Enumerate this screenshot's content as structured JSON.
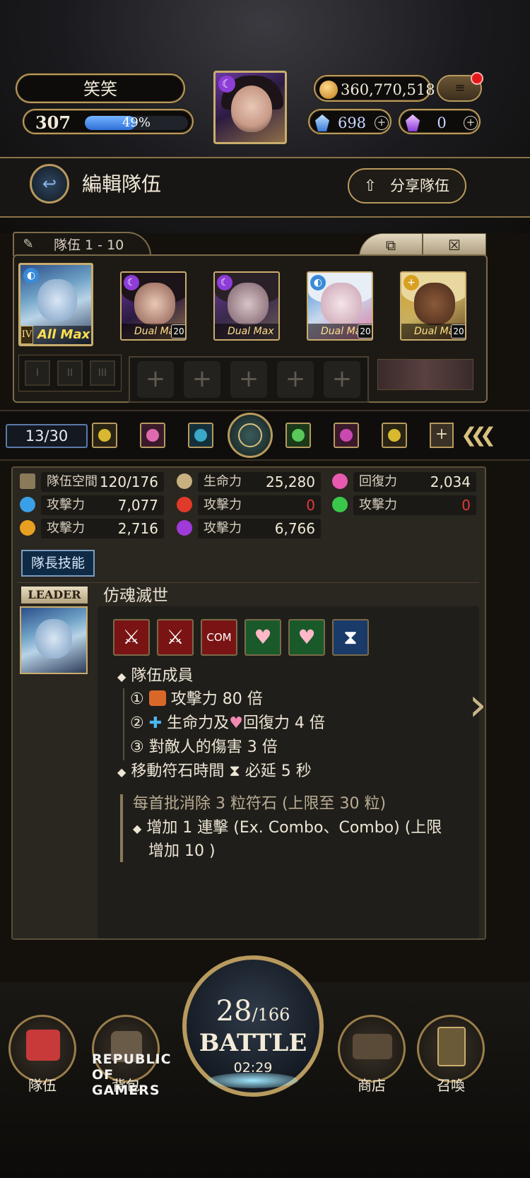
{
  "header": {
    "player_name": "笑笑",
    "level": "307",
    "exp_percent_label": "49%",
    "exp_fraction": 0.49,
    "coins": "360,770,518",
    "diamonds": "698",
    "crystals": "0",
    "plus_symbol": "+",
    "menu_glyph": "≡"
  },
  "edit": {
    "title": "編輯隊伍",
    "share_label": "分享隊伍",
    "back_glyph": "↩",
    "share_glyph": "⇧"
  },
  "team": {
    "tab_label": "隊伍 1 - 10",
    "copy_glyph": "⧉",
    "clear_glyph": "☒",
    "leader_rank": "IV",
    "leader_tag": "All Max",
    "members": [
      {
        "tag": "Dual Max",
        "level": "20",
        "attr": "moon",
        "attr_glyph": "☾",
        "color": "#8e3dd8"
      },
      {
        "tag": "Dual Max",
        "level": "",
        "attr": "moon",
        "attr_glyph": "☾",
        "color": "#8e3dd8"
      },
      {
        "tag": "Dual Max",
        "level": "20",
        "attr": "water",
        "attr_glyph": "◐",
        "color": "#3a8ad8"
      },
      {
        "tag": "Dual Max",
        "level": "20",
        "attr": "light",
        "attr_glyph": "+",
        "color": "#d8a020"
      }
    ],
    "sub_slots": [
      "I",
      "II",
      "III"
    ],
    "bench_plus": "+"
  },
  "selector": {
    "counter": "13/30",
    "chevrons": "❮❮❮",
    "add_glyph": "+"
  },
  "stats": {
    "space_label": "隊伍空間",
    "space_value": "120/176",
    "hp_label": "生命力",
    "hp_value": "25,280",
    "recovery_label": "回復力",
    "recovery_value": "2,034",
    "water_atk_label": "攻擊力",
    "water_atk_value": "7,077",
    "fire_atk_label": "攻擊力",
    "fire_atk_value": "0",
    "wood_atk_label": "攻擊力",
    "wood_atk_value": "0",
    "light_atk_label": "攻擊力",
    "light_atk_value": "2,716",
    "dark_atk_label": "攻擊力",
    "dark_atk_value": "6,766"
  },
  "leader_skill": {
    "button": "隊長技能",
    "leader_label": "LEADER",
    "name": "仿魂滅世",
    "icons": [
      "sword-up-icon",
      "sword-up-icon",
      "combo-icon",
      "heart-icon",
      "heart-plus-icon",
      "hourglass-icon"
    ],
    "com_text": "COM",
    "bullet": "◆",
    "heading1": "隊伍成員",
    "item1_num": "①",
    "item1_text": "攻擊力 80 倍",
    "item2_num": "②",
    "item2_text_a": "生命力及",
    "item2_text_b": "回復力 4 倍",
    "item3_num": "③",
    "item3_text": "對敵人的傷害 3 倍",
    "heading2_a": "移動符石時間",
    "heading2_b": "必延 5 秒",
    "sub_heading": "每首批消除 3 粒符石 (上限至 30 粒)",
    "sub_item_line1": "增加 1 連擊 (Ex. Combo、Combo) (上限",
    "sub_item_line2": "增加 10 )"
  },
  "nav": {
    "team": "隊伍",
    "bag": "背包",
    "shop": "商店",
    "summon": "召喚",
    "battle_count": "28",
    "battle_max": "/166",
    "battle_label": "BATTLE",
    "battle_timer": "02:29",
    "rog_line1": "REPUBLIC OF",
    "rog_line2": "GAMERS"
  },
  "colors": {
    "gold_frame": "#b89a5e",
    "exp_bar": "#2f6fd8",
    "warning_red": "#e23a3a",
    "notification_red": "#e4191c"
  }
}
